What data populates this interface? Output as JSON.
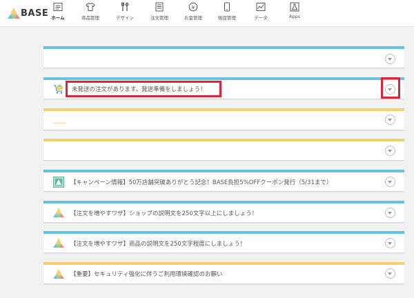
{
  "brand": {
    "name": "BASE"
  },
  "nav": [
    {
      "label": "ホーム",
      "icon": "home-icon",
      "active": true
    },
    {
      "label": "商品管理",
      "icon": "shirt-icon"
    },
    {
      "label": "デザイン",
      "icon": "brush-icon"
    },
    {
      "label": "注文管理",
      "icon": "order-icon"
    },
    {
      "label": "お金管理",
      "icon": "yen-icon"
    },
    {
      "label": "販促管理",
      "icon": "smartphone-icon"
    },
    {
      "label": "データ",
      "icon": "chart-icon"
    },
    {
      "label": "Apps",
      "icon": "flask-icon"
    }
  ],
  "colors": {
    "blue_stripe": "#66c3e0",
    "yellow_stripe": "#f5cf6b",
    "highlight": "#d7263d",
    "green_icon": "#5fb9a3"
  },
  "notifications": [
    {
      "id": "n1",
      "stripe": "blue",
      "text": ""
    },
    {
      "id": "n2",
      "stripe": "blue",
      "icon": "cart-icon",
      "text": "未発送の注文があります。発送準備をしましょう！",
      "highlighted": true
    },
    {
      "id": "n3",
      "stripe": "yellow",
      "text": ""
    },
    {
      "id": "n4",
      "stripe": "yellow",
      "text": ""
    },
    {
      "id": "n5",
      "stripe": "blue",
      "icon": "campaign-icon",
      "text": "【キャンペーン情報】50万店舗突破ありがとう記念！BASE負担5%OFFクーポン発行（5/31まで）"
    },
    {
      "id": "n6",
      "stripe": "blue",
      "icon": "base-logo-icon",
      "text": "【注文を増やすワザ】ショップの説明文を250文字以上にしましょう！"
    },
    {
      "id": "n7",
      "stripe": "blue",
      "icon": "base-logo-icon",
      "text": "【注文を増やすワザ】商品の説明文を250文字程度にしましょう！"
    },
    {
      "id": "n8",
      "stripe": "yellow",
      "icon": "base-logo-icon",
      "text": "【重要】セキュリティ強化に伴うご利用環境確認のお願い"
    }
  ]
}
